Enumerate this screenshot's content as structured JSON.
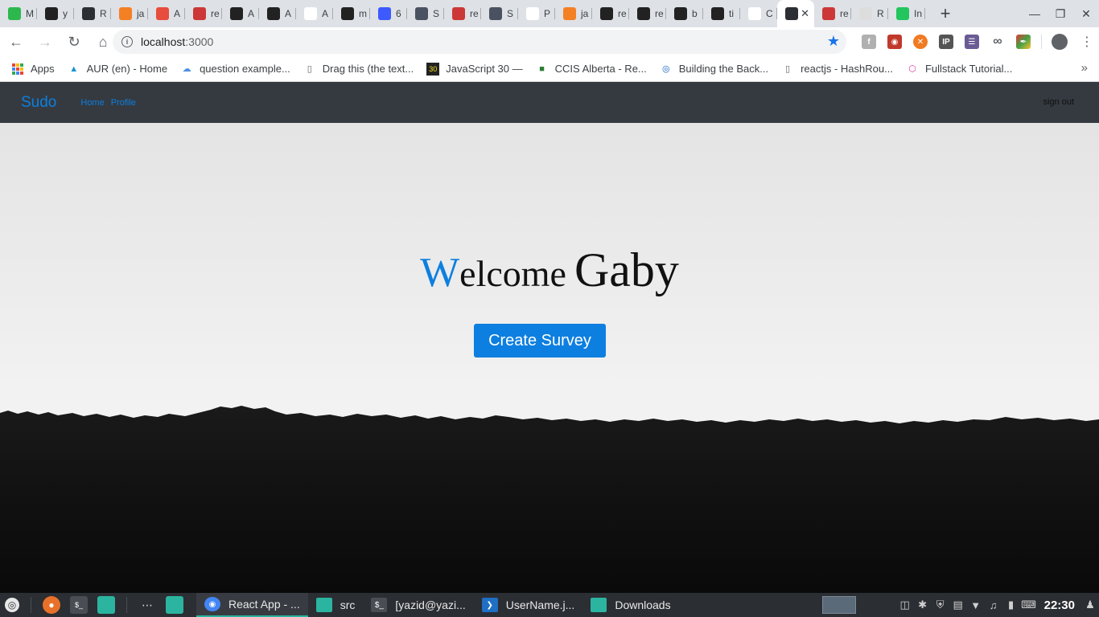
{
  "browser": {
    "tabs": [
      {
        "label": "M",
        "icon": "trello-icon",
        "color": "#2db84d"
      },
      {
        "label": "y",
        "icon": "github-icon",
        "color": "#222222"
      },
      {
        "label": "R",
        "icon": "react-icon",
        "color": "#2b2e33"
      },
      {
        "label": "ja",
        "icon": "stackoverflow-icon",
        "color": "#f48024"
      },
      {
        "label": "A",
        "icon": "asterisk-icon",
        "color": "#e84c3d"
      },
      {
        "label": "re",
        "icon": "npm-icon",
        "color": "#cb3837"
      },
      {
        "label": "A",
        "icon": "github-icon",
        "color": "#222222"
      },
      {
        "label": "A",
        "icon": "codepen-icon",
        "color": "#222222"
      },
      {
        "label": "A",
        "icon": "document-icon",
        "color": "#ffffff"
      },
      {
        "label": "m",
        "icon": "github-icon",
        "color": "#222222"
      },
      {
        "label": "6",
        "icon": "d-icon",
        "color": "#3d5afe"
      },
      {
        "label": "S",
        "icon": "tophat-icon",
        "color": "#4a5160"
      },
      {
        "label": "re",
        "icon": "npm-icon",
        "color": "#cb3837"
      },
      {
        "label": "S",
        "icon": "tophat-icon",
        "color": "#4a5160"
      },
      {
        "label": "P",
        "icon": "document-icon",
        "color": "#ffffff"
      },
      {
        "label": "ja",
        "icon": "stackoverflow-icon",
        "color": "#f48024"
      },
      {
        "label": "re",
        "icon": "github-icon",
        "color": "#222222"
      },
      {
        "label": "re",
        "icon": "github-icon",
        "color": "#222222"
      },
      {
        "label": "b",
        "icon": "github-icon",
        "color": "#222222"
      },
      {
        "label": "ti",
        "icon": "github-icon",
        "color": "#222222"
      },
      {
        "label": "C",
        "icon": "t-icon",
        "color": "#ffffff"
      },
      {
        "label": "",
        "icon": "react-icon",
        "color": "#2b2e33"
      },
      {
        "label": "re",
        "icon": "npm-icon",
        "color": "#cb3837"
      },
      {
        "label": "R",
        "icon": "ghost-icon",
        "color": "#dddddd"
      },
      {
        "label": "In",
        "icon": "timer-icon",
        "color": "#22c55e"
      }
    ],
    "active_tab_index": 21,
    "url_host": "localhost",
    "url_port": ":3000",
    "bookmarks": [
      {
        "label": "Apps",
        "icon": "apps-grid-icon"
      },
      {
        "label": "AUR (en) - Home",
        "icon": "arch-icon"
      },
      {
        "label": "question example...",
        "icon": "cloud-icon"
      },
      {
        "label": "Drag this (the text...",
        "icon": "document-icon"
      },
      {
        "label": "JavaScript 30 —",
        "icon": "js30-icon"
      },
      {
        "label": "CCIS Alberta - Re...",
        "icon": "ccis-icon"
      },
      {
        "label": "Building the Back...",
        "icon": "globe-icon"
      },
      {
        "label": "reactjs - HashRou...",
        "icon": "document-icon"
      },
      {
        "label": "Fullstack Tutorial...",
        "icon": "graphql-icon"
      }
    ]
  },
  "app": {
    "brand": "Sudo",
    "nav": {
      "home": "Home",
      "profile": "Profile"
    },
    "signout": "sign out",
    "welcome_first": "W",
    "welcome_rest": "elcome",
    "user_name": "Gaby",
    "cta_label": "Create Survey",
    "accent": "#0d7fe0"
  },
  "taskbar": {
    "tasks": [
      {
        "label": "React App - ...",
        "icon": "chrome-icon",
        "active": true
      },
      {
        "label": "src",
        "icon": "folder-icon",
        "active": false
      },
      {
        "label": "[yazid@yazi...",
        "icon": "terminal-icon",
        "active": false
      },
      {
        "label": "UserName.j...",
        "icon": "vscode-icon",
        "active": false
      },
      {
        "label": "Downloads",
        "icon": "folder-icon",
        "active": false
      }
    ],
    "clock": "22:30"
  }
}
